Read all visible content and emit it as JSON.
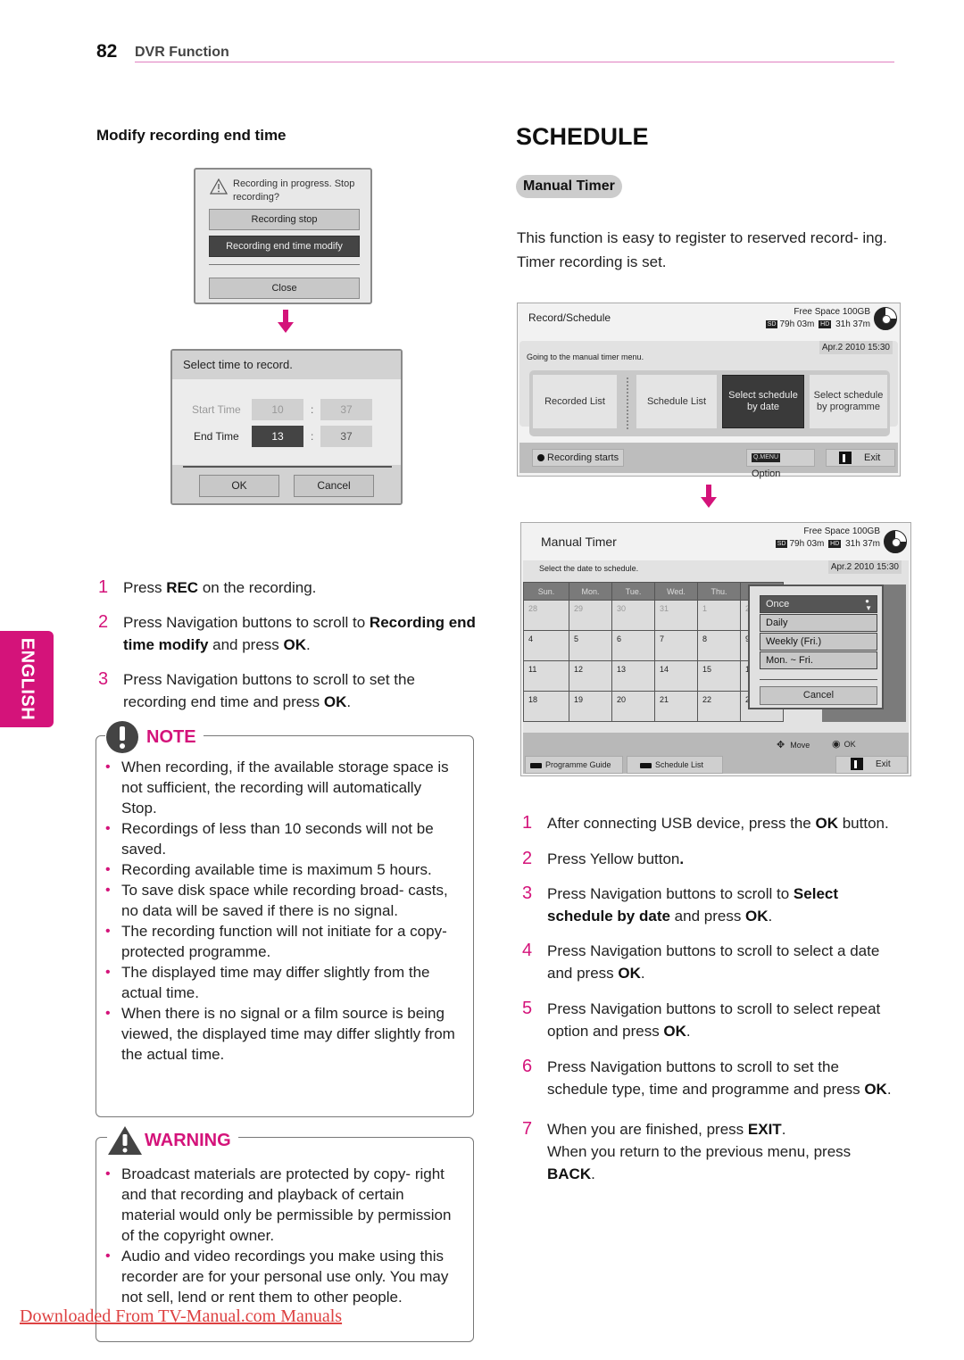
{
  "header": {
    "page_number": "82",
    "section": "DVR Function"
  },
  "language_tab": "ENGLISH",
  "left": {
    "heading": "Modify recording end time",
    "dialog_stop": {
      "message": "Recording in progress. Stop recording?",
      "buttons": [
        "Recording stop",
        "Recording end time modify",
        "Close"
      ],
      "selected": "Recording end time modify"
    },
    "dialog_time": {
      "title": "Select time to record.",
      "start_label": "Start Time",
      "start_hour": "10",
      "start_min": "37",
      "end_label": "End Time",
      "end_hour": "13",
      "end_min": "37",
      "separator": ":",
      "ok": "OK",
      "cancel": "Cancel"
    },
    "steps": [
      {
        "n": "1",
        "parts": [
          [
            "Press ",
            false
          ],
          [
            "REC",
            true
          ],
          [
            " on the recording.",
            false
          ]
        ]
      },
      {
        "n": "2",
        "parts": [
          [
            "Press Navigation buttons to scroll to ",
            false
          ],
          [
            "Recording end time modify",
            true
          ],
          [
            " and press ",
            false
          ],
          [
            "OK",
            true
          ],
          [
            ".",
            false
          ]
        ]
      },
      {
        "n": "3",
        "parts": [
          [
            "Press Navigation buttons to scroll to set the recording end time and press ",
            false
          ],
          [
            "OK",
            true
          ],
          [
            ".",
            false
          ]
        ]
      }
    ],
    "note": {
      "title": "NOTE",
      "items": [
        "When recording, if the available storage space is not sufficient, the recording will automatically Stop.",
        "Recordings of less than 10 seconds will not be saved.",
        "Recording available time is maximum 5 hours.",
        "To save disk space while recording broad- casts, no data will be saved if there is no signal.",
        "The recording function will not initiate for a copy-protected programme.",
        "The displayed time may differ slightly from the actual time.",
        "When there is no signal or a film source is being viewed, the displayed time may differ slightly from the actual time."
      ]
    },
    "warning": {
      "title": "WARNING",
      "items": [
        "Broadcast materials are protected by copy- right and that recording and playback of certain material would only be permissible by permission of the copyright owner.",
        "Audio and video recordings you make using this recorder are for your personal use only. You may not sell, lend or rent them to other people."
      ]
    }
  },
  "right": {
    "title": "SCHEDULE",
    "subsection": "Manual Timer",
    "intro": "This function is easy to register to reserved record- ing. Timer recording is set.",
    "screen_record": {
      "title": "Record/Schedule",
      "free_space": "Free Space 100GB",
      "sd_label": "SD",
      "sd_time": "79h 03m",
      "hd_label": "HD",
      "hd_time": "31h 37m",
      "datetime": "Apr.2 2010 15:30",
      "hint": "Going to the manual timer menu.",
      "menu": [
        "Recorded List",
        "Schedule List",
        "Select schedule by date",
        "Select schedule by programme"
      ],
      "selected": "Select schedule by date",
      "footer": {
        "rec": "Recording starts",
        "option_key": "Q.MENU",
        "option": "Option",
        "exit": "Exit"
      }
    },
    "screen_timer": {
      "title": "Manual Timer",
      "free_space": "Free Space 100GB",
      "sd_label": "SD",
      "sd_time": "79h 03m",
      "hd_label": "HD",
      "hd_time": "31h 37m",
      "datetime": "Apr.2 2010 15:30",
      "hint": "Select the date to schedule.",
      "weekdays": [
        "Sun.",
        "Mon.",
        "Tue.",
        "Wed.",
        "Thu."
      ],
      "weeks": [
        [
          "28",
          "29",
          "30",
          "31",
          "1",
          "2"
        ],
        [
          "4",
          "5",
          "6",
          "7",
          "8",
          "9"
        ],
        [
          "11",
          "12",
          "13",
          "14",
          "15",
          "1"
        ],
        [
          "18",
          "19",
          "20",
          "21",
          "22",
          "2"
        ]
      ],
      "repeat_options": [
        "Once",
        "Daily",
        "Weekly (Fri.)",
        "Mon. ~ Fri."
      ],
      "repeat_selected": "Once",
      "cancel": "Cancel",
      "legend": {
        "move": "Move",
        "ok": "OK"
      },
      "footer": {
        "guide": "Programme Guide",
        "schedule": "Schedule List",
        "exit": "Exit"
      }
    },
    "steps": [
      {
        "n": "1",
        "parts": [
          [
            "After connecting USB device, press the ",
            false
          ],
          [
            "OK",
            true
          ],
          [
            " button.",
            false
          ]
        ]
      },
      {
        "n": "2",
        "parts": [
          [
            "Press Yellow button",
            false
          ],
          [
            ".",
            true
          ]
        ]
      },
      {
        "n": "3",
        "parts": [
          [
            "Press Navigation buttons to scroll to ",
            false
          ],
          [
            "Select schedule by date",
            true
          ],
          [
            " and press ",
            false
          ],
          [
            "OK",
            true
          ],
          [
            ".",
            false
          ]
        ]
      },
      {
        "n": "4",
        "parts": [
          [
            "Press Navigation buttons to scroll to select a date and press ",
            false
          ],
          [
            "OK",
            true
          ],
          [
            ".",
            false
          ]
        ]
      },
      {
        "n": "5",
        "parts": [
          [
            "Press Navigation buttons to scroll to select repeat option and press ",
            false
          ],
          [
            "OK",
            true
          ],
          [
            ".",
            false
          ]
        ]
      },
      {
        "n": "6",
        "parts": [
          [
            "Press Navigation buttons to scroll to set the schedule type, time and programme and press ",
            false
          ],
          [
            "OK",
            true
          ],
          [
            ".",
            false
          ]
        ]
      },
      {
        "n": "7",
        "parts": [
          [
            "When you are finished, press ",
            false
          ],
          [
            "EXIT",
            true
          ],
          [
            ".",
            false
          ],
          [
            "\nWhen you return to the previous menu, press ",
            false
          ],
          [
            "BACK",
            true
          ],
          [
            ".",
            false
          ]
        ]
      }
    ]
  },
  "footer_link": "Downloaded From TV-Manual.com Manuals",
  "colors": {
    "accent": "#d4137a",
    "rule": "#e07fc0"
  }
}
